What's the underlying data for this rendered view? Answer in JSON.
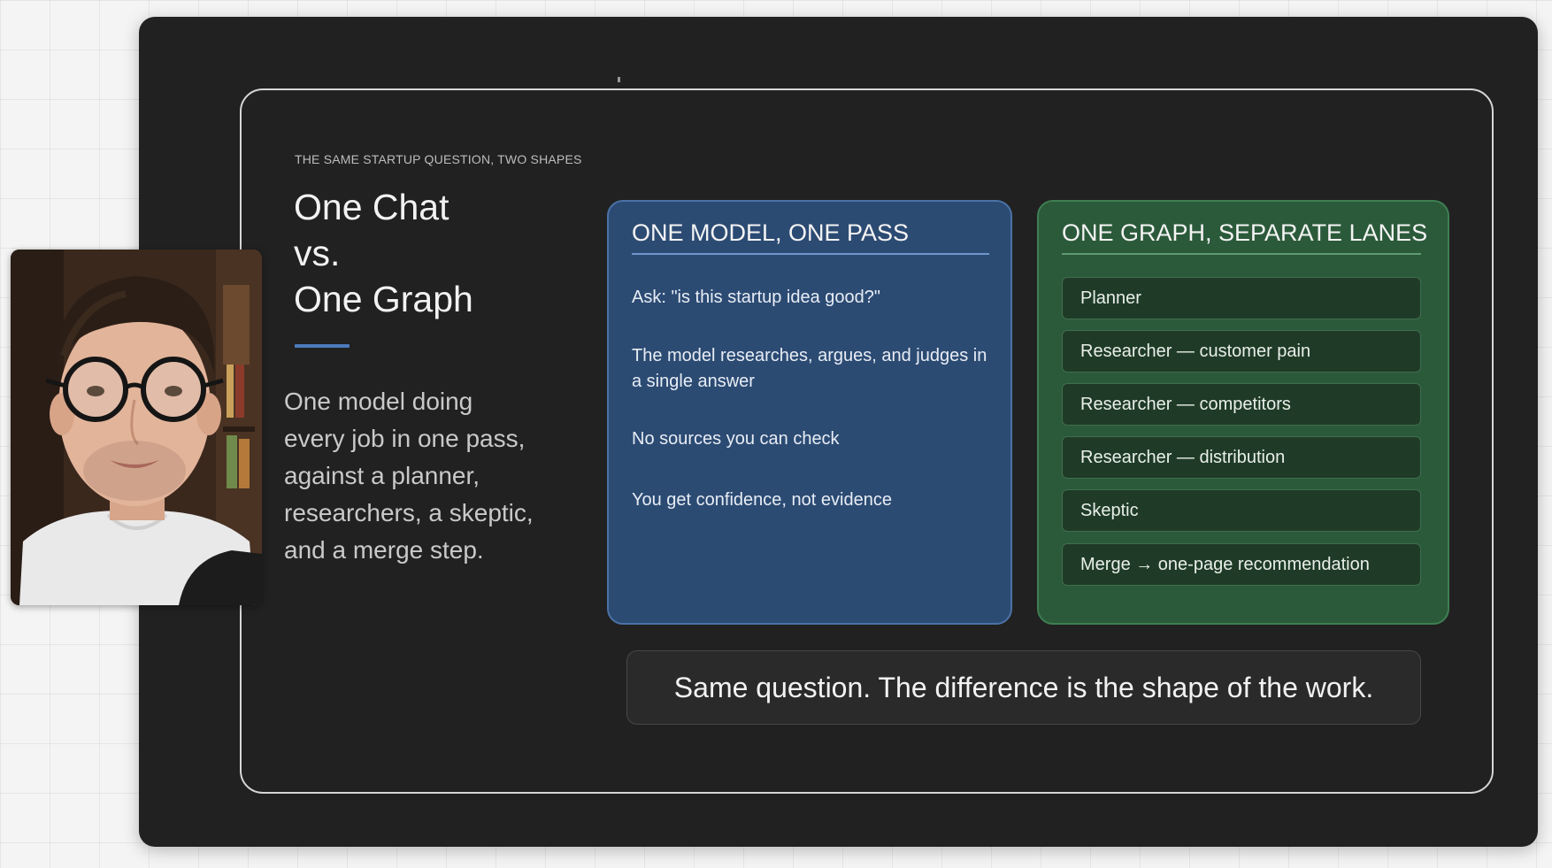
{
  "slide": {
    "eyebrow": "THE SAME STARTUP QUESTION, TWO SHAPES",
    "title_lines": [
      "One Chat",
      "vs.",
      "One Graph"
    ],
    "body_lines": [
      "One model doing",
      "every job in one pass,",
      "against a planner,",
      "researchers, a skeptic,",
      "and a merge step."
    ],
    "accent_color": "#4d7bbd"
  },
  "left_card": {
    "heading": "ONE MODEL, ONE PASS",
    "items": [
      "Ask: \"is this startup idea good?\"",
      "The model researches, argues, and judges in a single answer",
      "No sources you can check",
      "You get confidence, not evidence"
    ],
    "color": "#2c4b73"
  },
  "right_card": {
    "heading": "ONE GRAPH, SEPARATE LANES",
    "lanes": [
      "Planner",
      "Researcher — customer pain",
      "Researcher — competitors",
      "Researcher — distribution",
      "Skeptic",
      "Merge → one-page recommendation"
    ],
    "color": "#2b5a3a"
  },
  "takeaway": "Same question. The difference is the shape of the work.",
  "webcam": {
    "icon": "presenter-webcam"
  }
}
